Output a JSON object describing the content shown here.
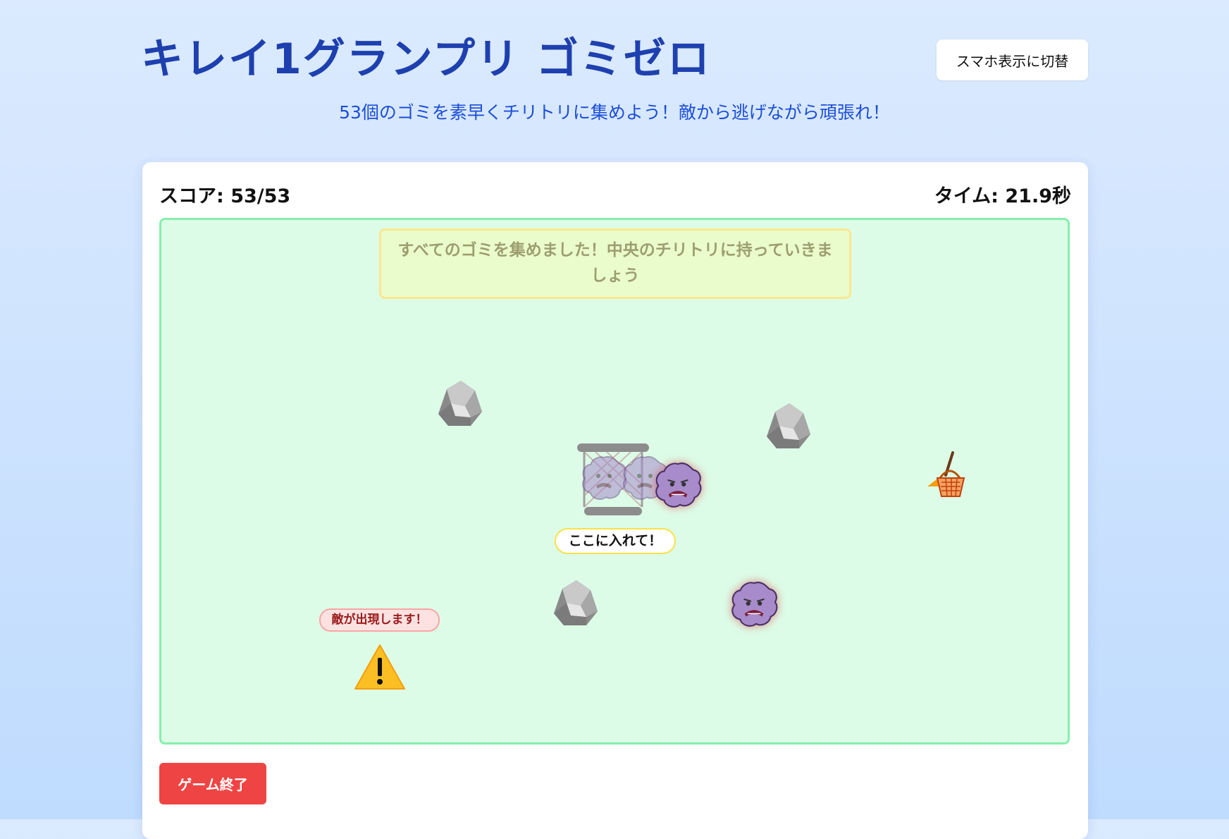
{
  "header": {
    "title": "キレイ1グランプリ ゴミゼロ",
    "switch_button": "スマホ表示に切替",
    "subtitle": "53個のゴミを素早くチリトリに集めよう！敵から逃げながら頑張れ！"
  },
  "status": {
    "score_text": "スコア: 53/53",
    "time_text": "タイム: 21.9秒"
  },
  "field": {
    "message": "すべてのゴミを集めました！中央のチリトリに持っていきましょう",
    "target_label": "ここに入れて！",
    "enemy_warning": "敵が出現します！"
  },
  "footer": {
    "end_button": "ゲーム終了"
  },
  "icons": [
    "rock-icon",
    "dustpan-icon",
    "dust-monster-icon",
    "warning-icon",
    "broom-basket-icon"
  ],
  "colors": {
    "title": "#1e40af",
    "field_bg": "#dcfce7",
    "field_border": "#86efac",
    "end_button": "#ef4444",
    "monster": "#a78bca"
  }
}
